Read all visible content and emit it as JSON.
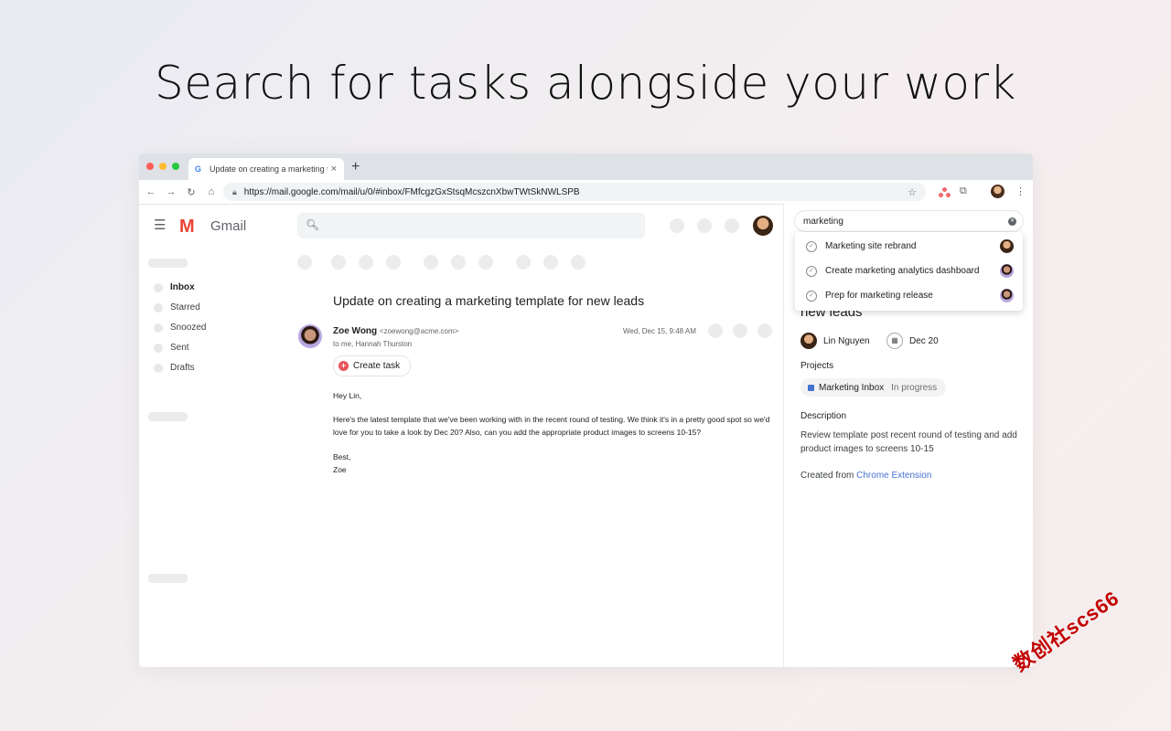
{
  "headline": "Search for tasks alongside your work",
  "browser": {
    "tab_title": "Update on creating a marketing t",
    "tab_close": "×",
    "new_tab": "+",
    "url": "https://mail.google.com/mail/u/0/#inbox/FMfcgzGxStsqMcszcnXbwTWtSkNWLSPB",
    "traffic_colors": [
      "#ff5f57",
      "#febc2e",
      "#28c840"
    ]
  },
  "gmail": {
    "brand": "Gmail",
    "nav": [
      "Inbox",
      "Starred",
      "Snoozed",
      "Sent",
      "Drafts"
    ],
    "subject": "Update on creating a marketing template for new leads",
    "sender_name": "Zoe Wong",
    "sender_email": "<zoewong@acme.com>",
    "recipients": "to me, Hannah Thurston",
    "date": "Wed, Dec 15, 9:48 AM",
    "create_task": "Create task",
    "body": {
      "greeting": "Hey Lin,",
      "paragraph": "Here's the latest template that we've been working with in the recent round of testing. We think it's in a pretty good spot so we'd love for you to take a look by Dec 20? Also, can you add the appropriate product images to screens 10-15?",
      "signoff": "Best,",
      "signature": "Zoe"
    }
  },
  "asana": {
    "search_value": "marketing",
    "results": [
      "Marketing site rebrand",
      "Create marketing analytics dashboard",
      "Prep for marketing release"
    ],
    "task_title_tail": "new leads",
    "assignee": "Lin Nguyen",
    "due_date": "Dec 20",
    "projects_label": "Projects",
    "project_name": "Marketing Inbox",
    "project_status": "In progress",
    "project_color": "#4573d2",
    "description_label": "Description",
    "description": "Review template post recent round of testing and add product images to screens 10-15",
    "created_prefix": "Created from",
    "created_link": "Chrome Extension"
  },
  "watermark": "数创社scs66"
}
